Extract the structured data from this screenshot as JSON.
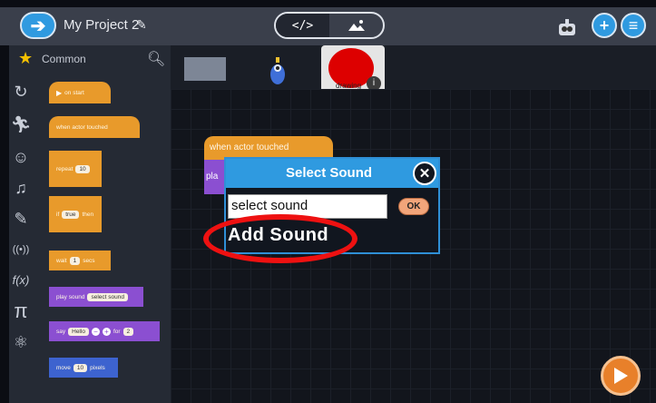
{
  "header": {
    "project_title": "My Project 2",
    "code_toggle_label": "</>",
    "stage_toggle_icon": "landscape-icon",
    "back_icon": "back-arrow-icon",
    "add_icon": "plus-icon",
    "menu_icon": "hamburger-icon"
  },
  "sidebar": {
    "category_title": "Common",
    "categories": [
      "common",
      "control",
      "motion",
      "looks",
      "sound",
      "pen",
      "sensing",
      "functions",
      "math",
      "physics"
    ],
    "blocks": [
      {
        "label": "on start",
        "color": "#e89a2b"
      },
      {
        "label": "when actor touched",
        "color": "#e89a2b"
      },
      {
        "label": "repeat",
        "value": "10",
        "color": "#e89a2b"
      },
      {
        "label": "if",
        "value": "true",
        "suffix": "then",
        "color": "#e89a2b"
      },
      {
        "label": "wait",
        "value": "1",
        "suffix": "secs",
        "color": "#e89a2b"
      },
      {
        "label": "play sound",
        "value": "select sound",
        "color": "#8b4fd1"
      },
      {
        "label": "say",
        "value": "Hello",
        "suffix": "for",
        "value2": "2",
        "color": "#8b4fd1"
      },
      {
        "label": "move",
        "value": "10",
        "suffix": "pixels",
        "color": "#3d63cf"
      }
    ]
  },
  "assets": {
    "drawing_label": "drawing"
  },
  "workspace": {
    "block_label": "when actor touched",
    "partial_block_label": "pla"
  },
  "dialog": {
    "title": "Select Sound",
    "input_value": "select sound",
    "ok_label": "OK",
    "add_sound_label": "Add Sound"
  },
  "colors": {
    "accent": "#2f9ae0",
    "highlight": "#ee1111",
    "play": "#e8802a"
  }
}
